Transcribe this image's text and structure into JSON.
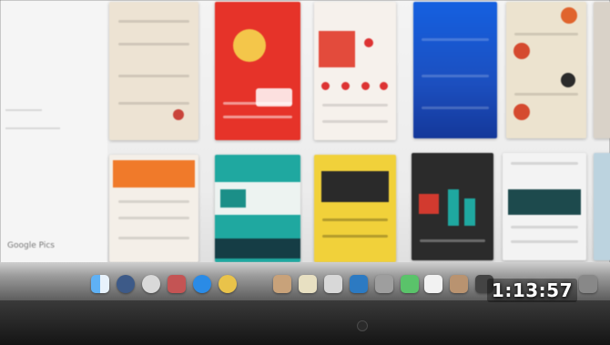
{
  "video": {
    "duration": "1:13:57"
  },
  "screen": {
    "left_panel_text": "Google Pics"
  },
  "colors": {
    "duration_text": "#ffffff",
    "card_red": "#e63329",
    "card_blue": "#1e5fd6",
    "card_teal": "#1fa8a0",
    "card_yellow": "#f1d13a",
    "card_dark": "#2b2b2b",
    "card_orange": "#f07a2a"
  },
  "icons": {
    "dock": [
      "finder-icon",
      "launchpad-icon",
      "safari-icon",
      "mail-icon",
      "app-store-icon",
      "chrome-icon",
      "folder-icon",
      "notes-icon",
      "preview-icon",
      "photos-icon",
      "settings-icon",
      "trash-icon"
    ]
  }
}
